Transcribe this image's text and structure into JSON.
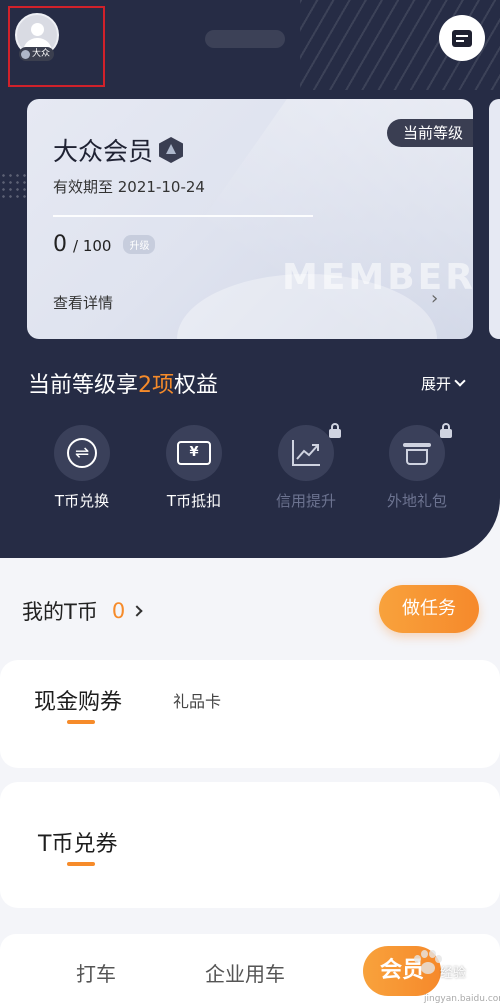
{
  "colors": {
    "accent": "#f68b2a",
    "navy": "#262c45",
    "highlight": "#d0212a"
  },
  "profile": {
    "level_badge": "大众"
  },
  "card": {
    "tag": "当前等级",
    "title": "大众会员",
    "expiry": "有效期至 2021-10-24",
    "points_current": "0",
    "points_total": "/ 100",
    "upgrade_label": "升级",
    "watermark": "MEMBER",
    "details_label": "查看详情"
  },
  "benefits": {
    "title_prefix": "当前等级享",
    "title_count": "2项",
    "title_suffix": "权益",
    "expand_label": "展开",
    "items": [
      {
        "label": "T币兑换",
        "icon": "exchange-icon",
        "locked": false
      },
      {
        "label": "T币抵扣",
        "icon": "yen-ticket-icon",
        "locked": false
      },
      {
        "label": "信用提升",
        "icon": "trend-up-icon",
        "locked": true
      },
      {
        "label": "外地礼包",
        "icon": "gift-pot-icon",
        "locked": true
      }
    ]
  },
  "tcoin": {
    "label": "我的T币",
    "value": "0",
    "task_button": "做任务"
  },
  "tabs_a": {
    "active": "现金购券",
    "inactive": "礼品卡"
  },
  "tabs_b": {
    "active": "T币兑券"
  },
  "bottom_nav": {
    "items": [
      "打车",
      "企业用车",
      "会员"
    ],
    "active_index": 2
  },
  "watermark": {
    "text": "经验",
    "sub": "jingyan.baidu.com"
  }
}
